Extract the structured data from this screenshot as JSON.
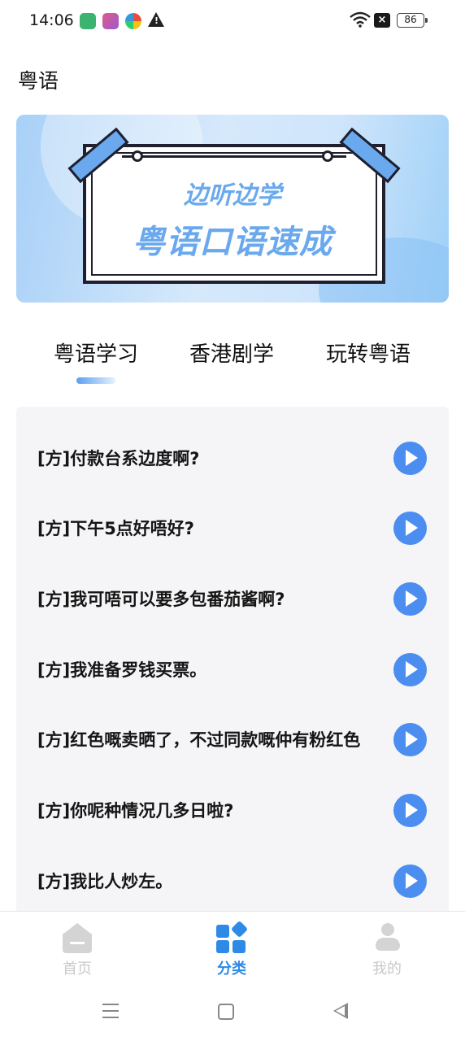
{
  "status_bar": {
    "time": "14:06",
    "battery": "86",
    "icons": [
      "app-green-icon",
      "app-pink-icon",
      "app-colorful-icon",
      "warning-icon",
      "wifi-icon",
      "close-box-icon",
      "battery-icon"
    ]
  },
  "header": {
    "title": "粤语"
  },
  "banner": {
    "subtitle": "边听边学",
    "title": "粤语口语速成"
  },
  "tabs": [
    {
      "label": "粤语学习",
      "active": true
    },
    {
      "label": "香港剧学",
      "active": false
    },
    {
      "label": "玩转粤语",
      "active": false
    }
  ],
  "phrases": [
    "[方]付款台系边度啊?",
    "[方]下午5点好唔好?",
    "[方]我可唔可以要多包番茄酱啊?",
    "[方]我准备罗钱买票。",
    "[方]红色嘅卖晒了，不过同款嘅仲有粉红色",
    "[方]你呢种情况几多日啦?",
    "[方]我比人炒左。"
  ],
  "bottom_nav": [
    {
      "label": "首页",
      "icon": "home-icon",
      "active": false
    },
    {
      "label": "分类",
      "icon": "category-icon",
      "active": true
    },
    {
      "label": "我的",
      "icon": "profile-icon",
      "active": false
    }
  ],
  "colors": {
    "accent": "#4b8ef0",
    "active_nav": "#2e8ae6",
    "inactive_nav": "#c9c9c9",
    "list_bg": "#f5f5f8"
  }
}
